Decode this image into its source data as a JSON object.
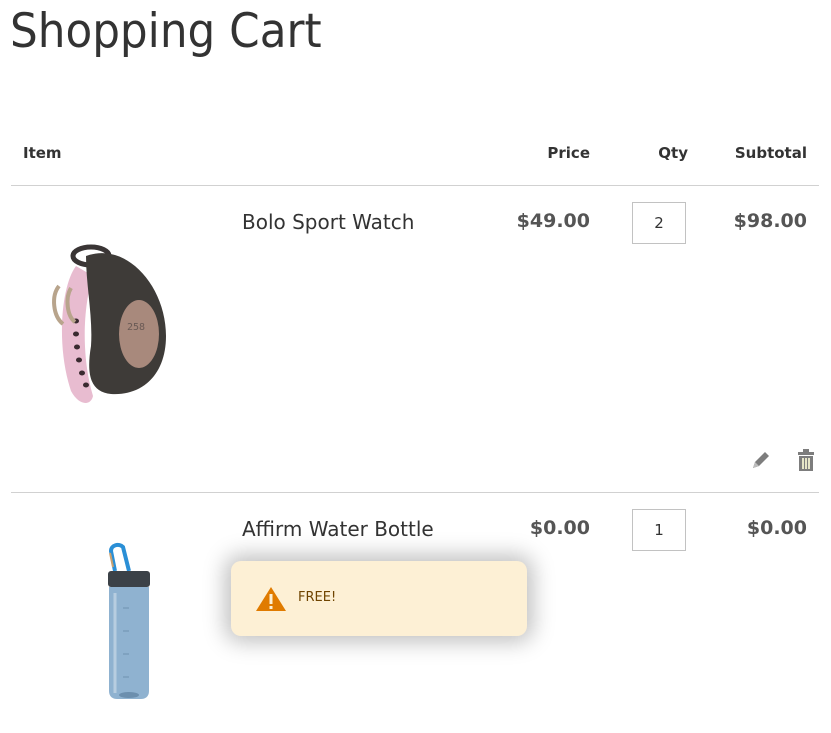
{
  "page": {
    "title": "Shopping Cart"
  },
  "table": {
    "headers": {
      "item": "Item",
      "price": "Price",
      "qty": "Qty",
      "subtotal": "Subtotal"
    },
    "rows": [
      {
        "name": "Bolo Sport Watch",
        "price": "$49.00",
        "qty": "2",
        "subtotal": "$98.00",
        "image": "watch-image",
        "actions": [
          "edit-icon",
          "trash-icon"
        ]
      },
      {
        "name": "Affirm Water Bottle",
        "price": "$0.00",
        "qty": "1",
        "subtotal": "$0.00",
        "image": "water-bottle-image"
      }
    ]
  },
  "notification": {
    "type": "warning",
    "icon": "warning-icon",
    "message": "FREE!",
    "colors": {
      "background": "#fdf0d5",
      "text": "#6f4400",
      "icon": "#e07b00"
    }
  }
}
